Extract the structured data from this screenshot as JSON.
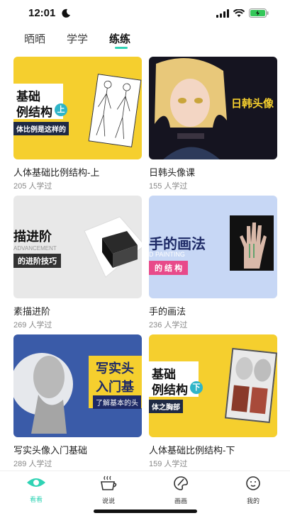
{
  "status": {
    "time": "12:01"
  },
  "tabs": [
    {
      "label": "晒晒"
    },
    {
      "label": "学学"
    },
    {
      "label": "练练"
    }
  ],
  "cards": [
    {
      "title": "人体基础比例结构-上",
      "count": "205 人学过",
      "thumb": {
        "line1": "基础",
        "line2": "例结构",
        "badge": "上",
        "sub": "体比例是这样的"
      }
    },
    {
      "title": "日韩头像课",
      "count": "155 人学过",
      "thumb": {
        "line1": "日韩头像"
      }
    },
    {
      "title": "素描进阶",
      "count": "269 人学过",
      "thumb": {
        "line1": "描进阶",
        "line2": "ADVANCEMENT",
        "sub": "的进阶技巧"
      }
    },
    {
      "title": "手的画法",
      "count": "236 人学过",
      "thumb": {
        "line1": "手的画法",
        "line2": "D PAINTING",
        "sub": "的 结 构"
      }
    },
    {
      "title": "写实头像入门基础",
      "count": "289 人学过",
      "thumb": {
        "line1": "写实头",
        "line2": "入门基",
        "sub": "了解基本的头"
      }
    },
    {
      "title": "人体基础比例结构-下",
      "count": "159 人学过",
      "thumb": {
        "line1": "基础",
        "line2": "例结构",
        "badge": "下",
        "sub": "体之胸部"
      }
    }
  ],
  "tabbar": [
    {
      "label": "看看",
      "icon": "eye-icon"
    },
    {
      "label": "说说",
      "icon": "coffee-cup-icon"
    },
    {
      "label": "画画",
      "icon": "palette-icon"
    },
    {
      "label": "我的",
      "icon": "face-icon"
    }
  ],
  "colors": {
    "accent": "#2fd3b4",
    "yellow": "#f5cf2e",
    "blue": "#3a5ba8"
  }
}
